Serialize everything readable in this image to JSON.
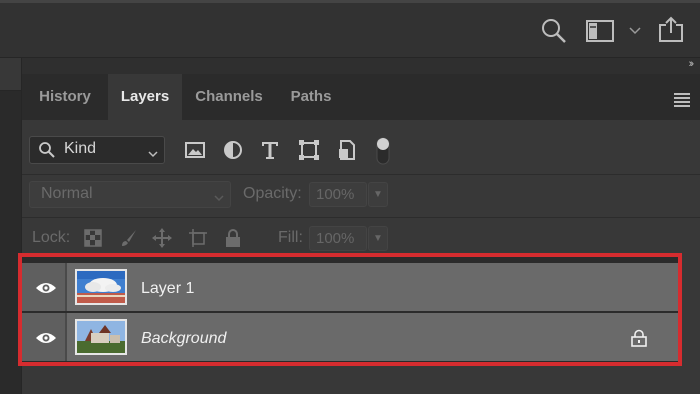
{
  "toolbar": {
    "search_icon": "search-icon",
    "workspace_icon": "workspace-icon",
    "share_icon": "share-icon"
  },
  "panel": {
    "collapse_glyph": "››",
    "tabs": [
      {
        "label": "History",
        "active": false
      },
      {
        "label": "Layers",
        "active": true
      },
      {
        "label": "Channels",
        "active": false
      },
      {
        "label": "Paths",
        "active": false
      }
    ],
    "filter": {
      "kind_label": "Kind",
      "icons": [
        "image-filter-icon",
        "adjustment-filter-icon",
        "type-filter-icon",
        "shape-filter-icon",
        "smart-object-filter-icon"
      ]
    },
    "blend": {
      "mode": "Normal",
      "opacity_label": "Opacity:",
      "opacity_value": "100%"
    },
    "locks": {
      "label": "Lock:",
      "fill_label": "Fill:",
      "fill_value": "100%"
    },
    "layers": [
      {
        "name": "Layer 1",
        "italic": false,
        "locked": false,
        "visible": true
      },
      {
        "name": "Background",
        "italic": true,
        "locked": true,
        "visible": true
      }
    ]
  },
  "colors": {
    "highlight_border": "#d62c2f",
    "layer_row": "#6a6a6a",
    "panel_bg": "#383838"
  }
}
